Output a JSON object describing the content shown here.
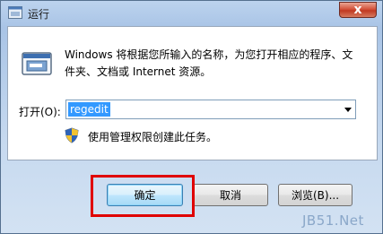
{
  "window": {
    "title": "运行",
    "close_label": "x",
    "icon": "run-icon"
  },
  "content": {
    "app_icon": "run-program-icon",
    "description": "Windows 将根据您所输入的名称，为您打开相应的程序、文件夹、文档或 Internet 资源。",
    "open_label": "打开(O):",
    "command_value": "regedit",
    "admin_icon": "uac-shield-icon",
    "admin_note": "使用管理权限创建此任务。"
  },
  "buttons": {
    "ok_label": "确定",
    "cancel_label": "取消",
    "browse_label": "浏览(B)..."
  },
  "annotation": {
    "highlight_color": "#e00000"
  },
  "watermark": {
    "text": "JB51.Net"
  }
}
